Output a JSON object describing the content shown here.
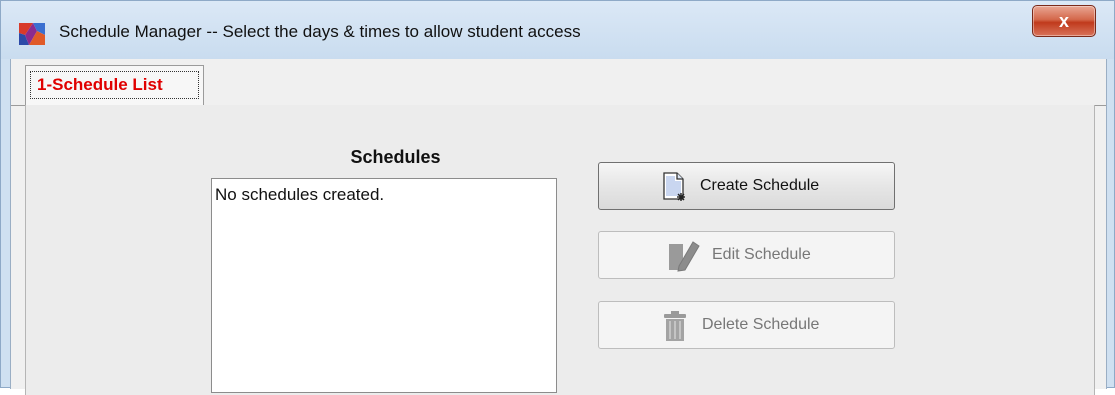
{
  "window": {
    "title": "Schedule Manager -- Select the days & times to allow student access",
    "close_label": "x"
  },
  "tabs": [
    {
      "label": "1-Schedule List",
      "selected": true,
      "color": "#e00000"
    }
  ],
  "schedules": {
    "title": "Schedules",
    "empty_text": "No schedules created.",
    "items": []
  },
  "actions": {
    "create": {
      "label": "Create Schedule",
      "enabled": true,
      "icon": "new-document-icon"
    },
    "edit": {
      "label": "Edit Schedule",
      "enabled": false,
      "icon": "edit-pencil-icon"
    },
    "delete": {
      "label": "Delete Schedule",
      "enabled": false,
      "icon": "trash-can-icon"
    }
  }
}
